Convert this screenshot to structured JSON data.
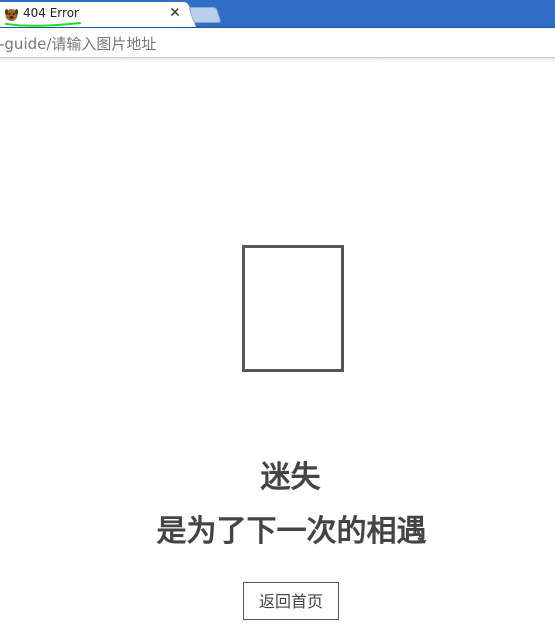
{
  "browser": {
    "tab": {
      "title": "404 Error",
      "favicon": "dog-favicon-icon",
      "close_glyph": "✕"
    },
    "address_bar": {
      "url": "-guide/请输入图片地址"
    }
  },
  "page": {
    "image_placeholder": "broken-image-icon",
    "headline": "迷失",
    "subline": "是为了下一次的相遇",
    "home_button_label": "返回首页"
  },
  "colors": {
    "tabbar": "#2f6fc6",
    "text_dark": "#444444",
    "underline_annotation": "#22dd22"
  }
}
